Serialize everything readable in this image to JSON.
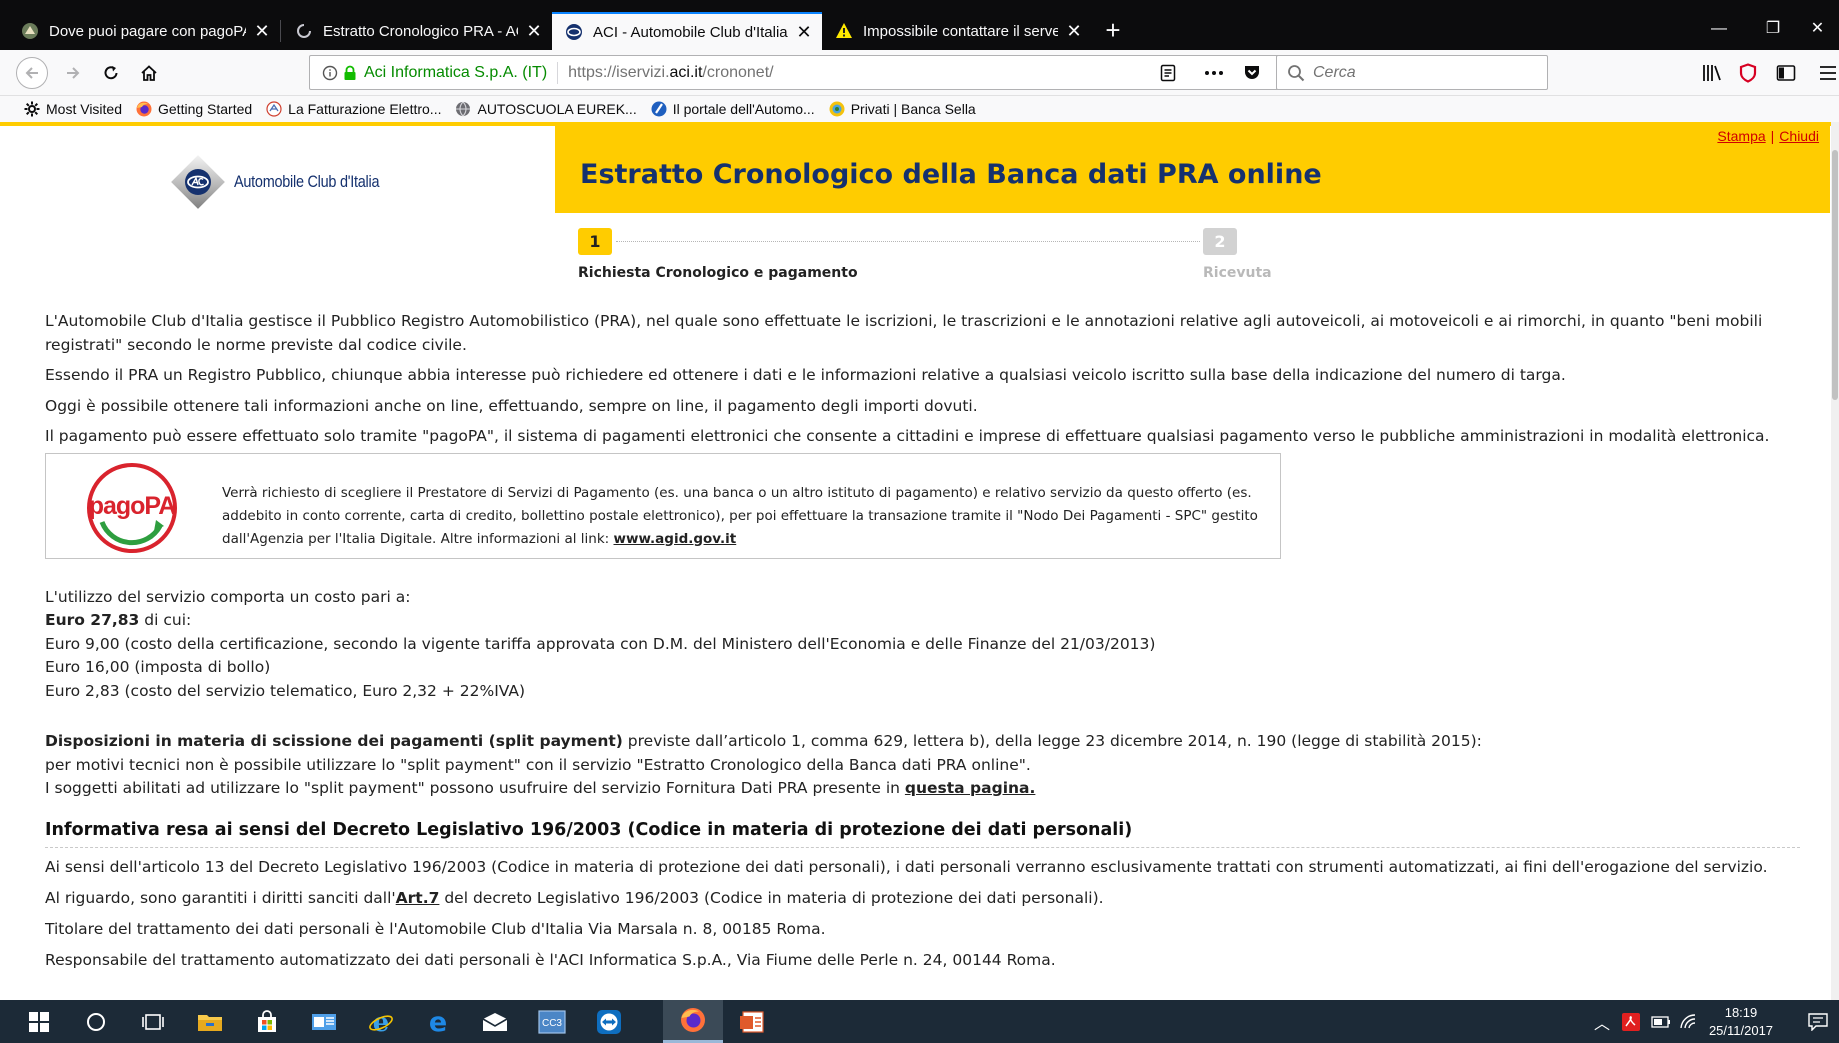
{
  "browser": {
    "tabs": [
      {
        "label": "Dove puoi pagare con pagoPA",
        "icon": "aci-tab-icon",
        "active": false
      },
      {
        "label": "Estratto Cronologico PRA - ACI",
        "icon": "loading-icon",
        "active": false
      },
      {
        "label": "ACI - Automobile Club d'Italia - ",
        "icon": "aci-icon",
        "active": true
      },
      {
        "label": "Impossibile contattare il server",
        "icon": "warning-icon",
        "active": false
      }
    ],
    "new_tab": "+",
    "url_identity": "Aci Informatica S.p.A. (IT)",
    "url_prefix": "https://iservizi.",
    "url_domain": "aci.it",
    "url_path": "/crononet/",
    "search_placeholder": "Cerca",
    "bookmarks": [
      {
        "label": "Most Visited",
        "icon": "gear-icon"
      },
      {
        "label": "Getting Started",
        "icon": "firefox-icon"
      },
      {
        "label": "La Fatturazione Elettro...",
        "icon": "invoice-icon"
      },
      {
        "label": "AUTOSCUOLA EUREK...",
        "icon": "globe-icon"
      },
      {
        "label": "Il portale dell'Automo...",
        "icon": "portal-icon"
      },
      {
        "label": "Privati | Banca Sella",
        "icon": "bank-icon"
      }
    ]
  },
  "page": {
    "brand": "Automobile Club d'Italia",
    "title": "Estratto Cronologico della Banca dati PRA online",
    "links": {
      "print": "Stampa",
      "close": "Chiudi"
    },
    "steps": [
      {
        "number": "1",
        "label": "Richiesta Cronologico e pagamento",
        "active": true
      },
      {
        "number": "2",
        "label": "Ricevuta",
        "active": false
      }
    ],
    "intro": [
      "L'Automobile Club d'Italia gestisce il Pubblico Registro Automobilistico (PRA), nel quale sono effettuate le iscrizioni, le trascrizioni e le annotazioni relative agli autoveicoli, ai motoveicoli e ai rimorchi, in quanto \"beni mobili registrati\" secondo le norme previste dal codice civile.",
      "Essendo il PRA un Registro Pubblico, chiunque abbia interesse può richiedere ed ottenere i dati e le informazioni relative a qualsiasi veicolo iscritto sulla base della indicazione del numero di targa.",
      "Oggi è possibile ottenere tali informazioni anche on line, effettuando, sempre on line, il pagamento degli importi dovuti.",
      "Il pagamento può essere effettuato solo tramite \"pagoPA\", il sistema di pagamenti elettronici che consente a cittadini e imprese di effettuare qualsiasi pagamento verso le pubbliche amministrazioni in modalità elettronica."
    ],
    "pagopa": {
      "logo_text": "pagoPA",
      "text": "Verrà richiesto di scegliere il Prestatore di Servizi di Pagamento (es. una banca o un altro istituto di pagamento) e relativo servizio da questo offerto (es. addebito in conto corrente, carta di credito, bollettino postale elettronico), per poi effettuare la transazione tramite il \"Nodo Dei Pagamenti - SPC\" gestito dall'Agenzia per l'Italia Digitale. Altre informazioni al link: ",
      "link": "www.agid.gov.it"
    },
    "cost": {
      "intro": "L'utilizzo del servizio comporta un costo pari a:",
      "total": "Euro 27,83",
      "total_suffix": " di cui:",
      "items": [
        "Euro 9,00 (costo della certificazione, secondo la vigente tariffa approvata con D.M. del Ministero dell'Economia e delle Finanze del 21/03/2013)",
        "Euro 16,00 (imposta di bollo)",
        "Euro 2,83 (costo del servizio telematico, Euro 2,32 + 22%IVA)"
      ]
    },
    "split": {
      "heading": "Disposizioni in materia di scissione dei pagamenti (split payment)",
      "heading_suffix": " previste dall’articolo 1, comma 629, lettera b), della legge 23 dicembre 2014, n. 190 (legge di stabilità 2015):",
      "line2": "per motivi tecnici non è possibile utilizzare lo \"split payment\" con il servizio \"Estratto Cronologico della Banca dati PRA online\".",
      "line3": "I soggetti abilitati ad utilizzare lo \"split payment\" possono usufruire del servizio Fornitura Dati PRA presente in ",
      "link": "questa pagina."
    },
    "privacy": {
      "heading": "Informativa resa ai sensi del Decreto Legislativo 196/2003 (Codice in materia di protezione dei dati personali)",
      "p1": "Ai sensi dell'articolo 13 del Decreto Legislativo 196/2003 (Codice in materia di protezione dei dati personali), i dati personali verranno esclusivamente trattati con strumenti automatizzati, ai fini dell'erogazione del servizio.",
      "p2_prefix": "Al riguardo, sono garantiti i diritti sanciti dall'",
      "p2_link": "Art.7",
      "p2_suffix": " del decreto Legislativo 196/2003 (Codice in materia di protezione dei dati personali).",
      "p3": "Titolare del trattamento dei dati personali è l'Automobile Club d'Italia Via Marsala n. 8, 00185 Roma.",
      "p4": "Responsabile del trattamento automatizzato dei dati personali è l'ACI Informatica S.p.A., Via Fiume delle Perle n. 24, 00144 Roma."
    }
  },
  "taskbar": {
    "time": "18:19",
    "date": "25/11/2017",
    "apps": [
      "start",
      "search",
      "task-view",
      "file-explorer",
      "store",
      "outlook",
      "internet-explorer",
      "edge",
      "mail",
      "cc3",
      "teamviewer",
      "firefox",
      "acrobat"
    ]
  },
  "colors": {
    "brand_yellow": "#ffcc00",
    "title_blue": "#15316e",
    "link_red": "#d00000",
    "secure_green": "#058b00",
    "tab_strip": "#0c0c0d",
    "taskbar": "#1c2a37"
  }
}
